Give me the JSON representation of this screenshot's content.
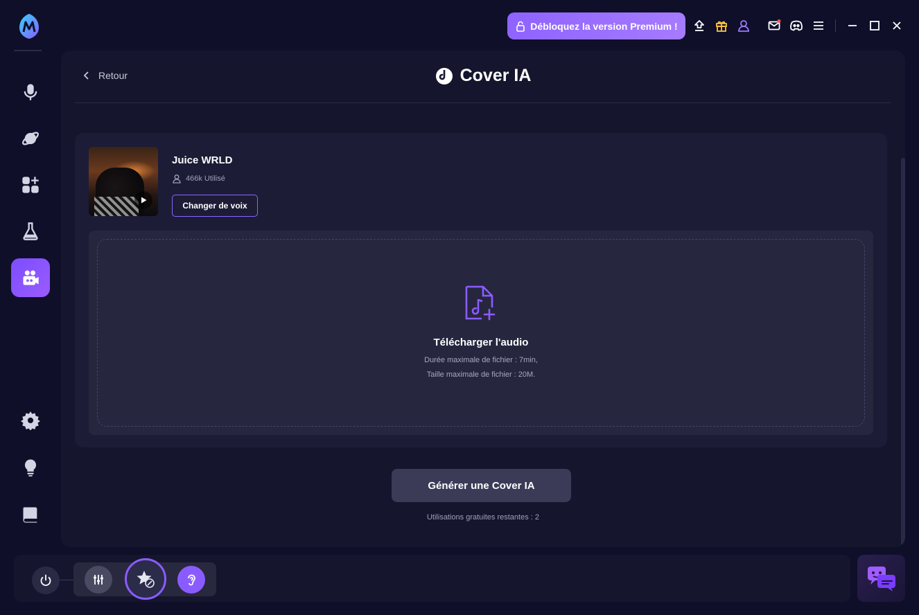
{
  "topbar": {
    "premium_label": "Débloquez la version Premium !"
  },
  "sidebar": {
    "items": [
      {
        "icon": "microphone-icon"
      },
      {
        "icon": "planet-icon"
      },
      {
        "icon": "apps-plus-icon"
      },
      {
        "icon": "flask-icon"
      },
      {
        "icon": "video-people-icon",
        "active": true
      },
      {
        "icon": "gear-icon"
      },
      {
        "icon": "lightbulb-icon"
      },
      {
        "icon": "book-icon"
      }
    ]
  },
  "main": {
    "back_label": "Retour",
    "title": "Cover IA",
    "voice": {
      "name": "Juice WRLD",
      "uses": "466k Utilisé",
      "change_label": "Changer de voix"
    },
    "upload": {
      "title": "Télécharger l'audio",
      "note_duration": "Durée maximale de fichier : 7min,",
      "note_size": "Taille maximale de fichier : 20M."
    },
    "generate_label": "Générer une Cover IA",
    "free_uses": "Utilisations gratuites restantes : 2"
  },
  "colors": {
    "accent": "#8a5cff",
    "background": "#0f0f2a",
    "panel": "#15152e"
  }
}
